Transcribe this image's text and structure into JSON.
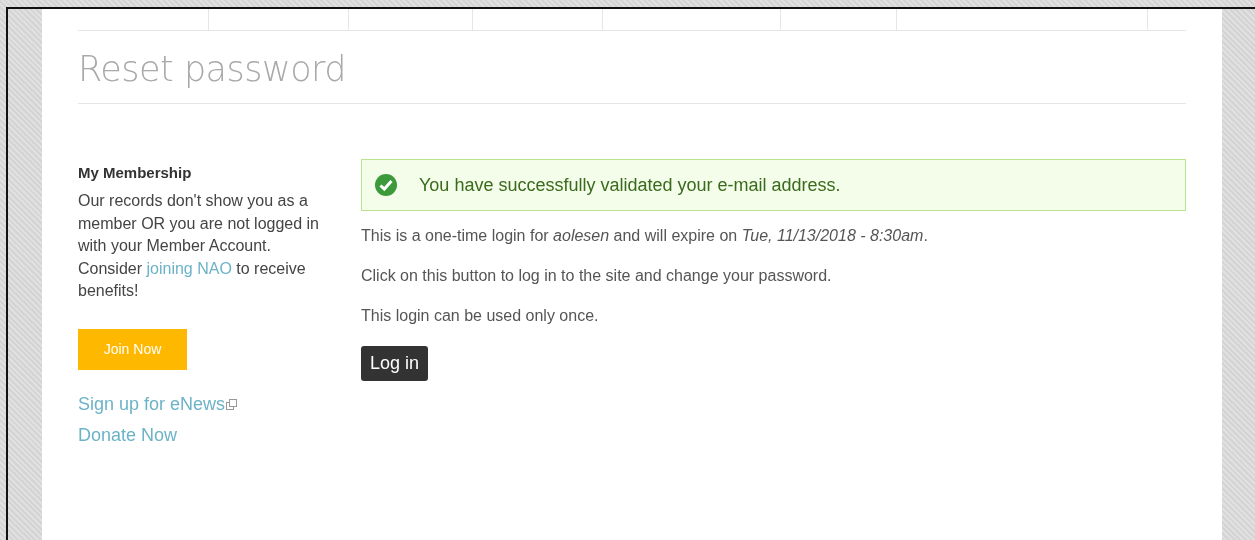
{
  "page_title": "Reset password",
  "sidebar": {
    "title": "My Membership",
    "notice": {
      "before": "Our records don't show you as a member OR you are not logged in with your Member Account. Consider ",
      "link": "joining NAO",
      "after": " to receive benefits!"
    },
    "join_button": "Join Now",
    "links": [
      {
        "label": "Sign up for eNews",
        "external": true
      },
      {
        "label": "Donate Now",
        "external": false
      }
    ]
  },
  "alert": {
    "kind": "success",
    "message": "You have successfully validated your e-mail address."
  },
  "paragraphs": [
    "This is a one-time login for *aolesen* and will expire on *Tue, 11/13/2018 - 8:30am*.",
    "Click on this button to log in to the site and change your password.",
    "This login can be used only once."
  ],
  "login_button": "Log in"
}
